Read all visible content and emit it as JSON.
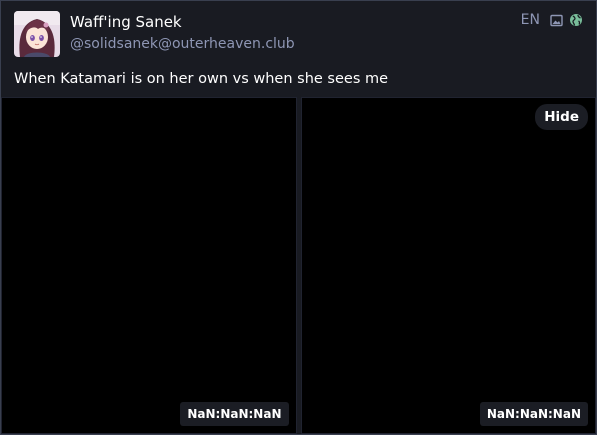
{
  "post": {
    "author": {
      "display_name": "Waff'ing Sanek",
      "handle": "@solidsanek@outerheaven.club",
      "avatar": "anime-girl-avatar"
    },
    "meta": {
      "language": "EN",
      "attachment_icon": "image-icon",
      "visibility_icon": "globe-icon"
    },
    "content": "When Katamari is on her own vs when she sees me",
    "media": {
      "hide_label": "Hide",
      "items": [
        {
          "timestamp": "NaN:NaN:NaN"
        },
        {
          "timestamp": "NaN:NaN:NaN"
        }
      ]
    }
  },
  "colors": {
    "background": "#191b22",
    "secondary_text": "#8e96b4",
    "border": "#393f4f",
    "globe": "#79bd9a"
  }
}
